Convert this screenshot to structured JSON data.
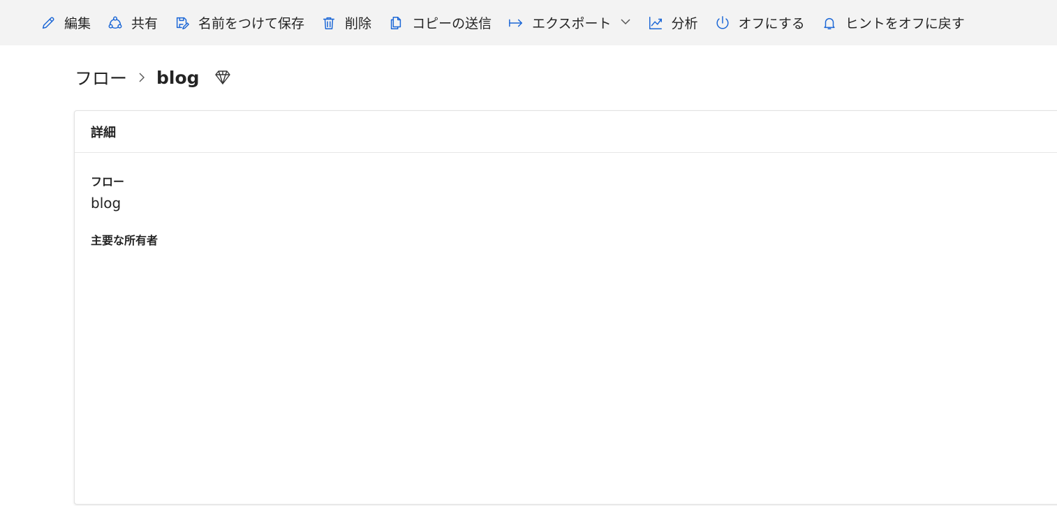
{
  "commandbar": {
    "items": [
      {
        "label": "編集",
        "icon": "pencil-icon"
      },
      {
        "label": "共有",
        "icon": "share-icon"
      },
      {
        "label": "名前をつけて保存",
        "icon": "save-as-icon"
      },
      {
        "label": "削除",
        "icon": "trash-icon"
      },
      {
        "label": "コピーの送信",
        "icon": "copy-icon"
      },
      {
        "label": "エクスポート",
        "icon": "export-icon"
      },
      {
        "label": "分析",
        "icon": "analytics-icon"
      },
      {
        "label": "オフにする",
        "icon": "power-icon"
      },
      {
        "label": "ヒントをオフに戻す",
        "icon": "bell-icon"
      }
    ],
    "accent_color": "#1a66d6"
  },
  "breadcrumb": {
    "root": "フロー",
    "current": "blog"
  },
  "details": {
    "title": "詳細",
    "fields": [
      {
        "label": "フロー",
        "value": "blog"
      },
      {
        "label": "主要な所有者",
        "value": ""
      }
    ]
  }
}
